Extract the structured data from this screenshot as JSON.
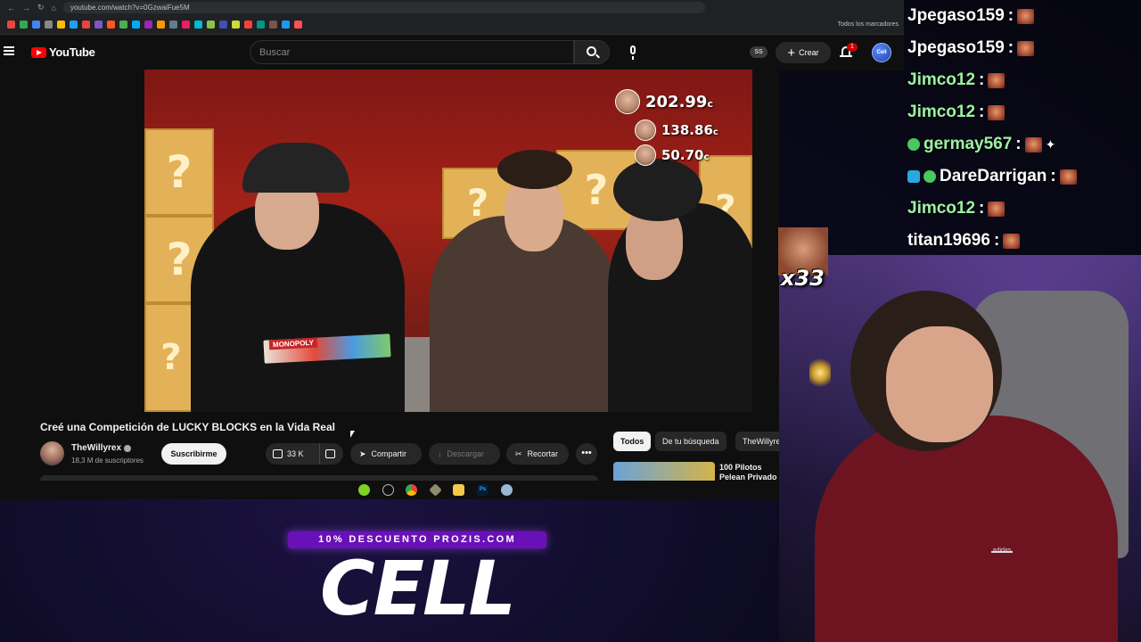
{
  "browser": {
    "url": "youtube.com/watch?v=0GzwaiFue5M",
    "bookmarks_folder": "Todos los marcadores"
  },
  "youtube": {
    "logo_text": "YouTube",
    "search_placeholder": "Buscar",
    "ss_badge": "SS",
    "create_label": "Crear",
    "notifications_count": "1",
    "account_initials": "Cell"
  },
  "video": {
    "title": "Creé una Competición de LUCKY BLOCKS en la Vida Real",
    "scores": [
      "202.99",
      "138.86",
      "50.70"
    ],
    "score_unit": "c",
    "monopoly_label": "MONOPOLY"
  },
  "channel": {
    "name": "TheWillyrex",
    "subscribers": "18,3 M de suscriptores",
    "subscribe_label": "Suscribirme"
  },
  "actions": {
    "likes": "33 K",
    "share": "Compartir",
    "download": "Descargar",
    "clip": "Recortar",
    "more": "•••"
  },
  "related": {
    "chips": [
      "Todos",
      "De tu búsqueda",
      "TheWillyrex"
    ],
    "first_title": "100 Pilotos Pelean Privado"
  },
  "chat": {
    "messages": [
      {
        "user": "Jpegaso159"
      },
      {
        "user": "Jpegaso159"
      },
      {
        "user": "Jimco12"
      },
      {
        "user": "Jimco12"
      },
      {
        "user": "germay567"
      },
      {
        "user": "DareDarrigan"
      },
      {
        "user": "Jimco12"
      },
      {
        "user": "titan19696"
      }
    ],
    "separator": ":"
  },
  "overlay": {
    "emote_combo": "x33",
    "promo_banner": "10% DESCUENTO PROZIS.COM",
    "promo_logo": "CELL",
    "adidas_text": "adidas"
  },
  "colors": {
    "youtube_red": "#ff0000",
    "promo_purple": "#6a10b8",
    "hoodie": "#6e1420"
  }
}
